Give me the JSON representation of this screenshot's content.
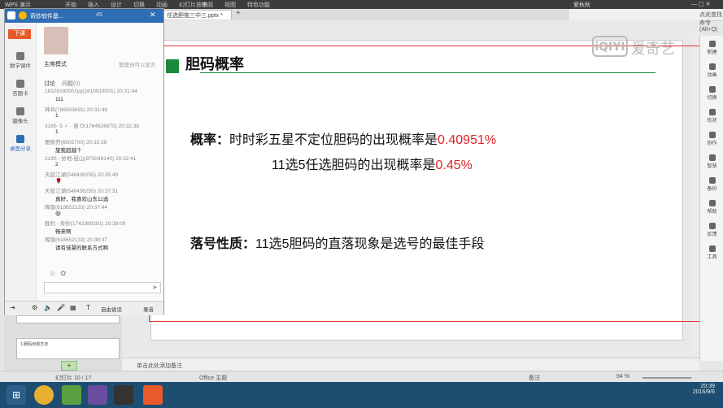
{
  "wps": {
    "app_name": "WPS 演示",
    "doc_tab": "任选胆拖三中三.pptx *",
    "menu": [
      "开始",
      "插入",
      "设计",
      "切换",
      "动画",
      "幻灯片放映",
      "审阅",
      "视图",
      "特色功能"
    ],
    "right_header": "点此查找命令 (Alt+Q)",
    "user": "爱秋秋"
  },
  "slide": {
    "title": "胆码概率",
    "line1_label": "概率：",
    "line1_text": "时时彩五星不定位胆码的出现概率是",
    "line1_value": "0.40951%",
    "line2_text": "11选5任选胆码的出现概率是",
    "line2_value": "0.45%",
    "line3_label": "落号性质：",
    "line3_text": "11选5胆码的直落现象是选号的最佳手段"
  },
  "right_pane": [
    {
      "icon": "new-icon",
      "label": "新建"
    },
    {
      "icon": "animation-icon",
      "label": "动画"
    },
    {
      "icon": "switch-icon",
      "label": "切换"
    },
    {
      "icon": "shape-icon",
      "label": "形状"
    },
    {
      "icon": "collab-icon",
      "label": "协作"
    },
    {
      "icon": "smart-icon",
      "label": "智慧"
    },
    {
      "icon": "backup-icon",
      "label": "备份"
    },
    {
      "icon": "help-icon",
      "label": "帮助"
    },
    {
      "icon": "feedback-icon",
      "label": "反馈"
    },
    {
      "icon": "tools-icon",
      "label": "工具"
    }
  ],
  "chat": {
    "title": "奇妙软件基...",
    "count": "45",
    "download_label": "下课",
    "mode_label": "主席模式",
    "admin_note": "管理员可以发言",
    "tab_discuss": "讨论",
    "tab_question": "问题",
    "tab_question_count": "(0)",
    "side_items": [
      "数学课件",
      "答题卡",
      "摄像头",
      "桌面分享"
    ],
    "messages": [
      {
        "meta": "18109180001yy(1810918001) 20:31:44",
        "body": "111"
      },
      {
        "meta": "神兵(786503691) 20:31:48",
        "body": "1"
      },
      {
        "meta": "3180- 5 ✓ · 奋 ℧(1764826675) 20:32:38",
        "body": "1"
      },
      {
        "meta": "雅致乔(6505700) 20:32:38",
        "body": "旋我超越个"
      },
      {
        "meta": "2190 - 仿地-昆山(975049140) 20:32:41",
        "body": "2"
      },
      {
        "meta": "天蓝江湖(548436255) 20:35:49",
        "body": "🌹"
      },
      {
        "meta": "天蓝江湖(548436255) 20:37:31",
        "body": "真好，我喜欢山东11选"
      },
      {
        "meta": "辉煌(618652133) 20:37:44",
        "body": "😆"
      },
      {
        "meta": "胜利 - 奇妙(1743389291) 20:38:09",
        "body": "畅来啊"
      },
      {
        "meta": "辉煌(618652133) 20:38:37",
        "body": "请有佳慧的联系方式啊"
      }
    ],
    "toolbar_screen": "自由说话",
    "toolbar_record": "录音"
  },
  "thumbs": {
    "title": "1 胆码出现方法"
  },
  "notes_placeholder": "单击此处添加备注",
  "status": {
    "slide_count": "幻灯片 10 / 17",
    "theme": "Office 主题",
    "notes_btn": "备注",
    "zoom": "94 %"
  },
  "taskbar": {
    "time": "20:39",
    "date": "2016/9/6"
  },
  "watermark": "爱奇艺",
  "colors": {
    "accent_green": "#1a8a3a",
    "value_red": "#e02020",
    "frame_red": "#e03030",
    "chat_blue": "#2f6db4",
    "taskbar": "#1e4d72"
  }
}
